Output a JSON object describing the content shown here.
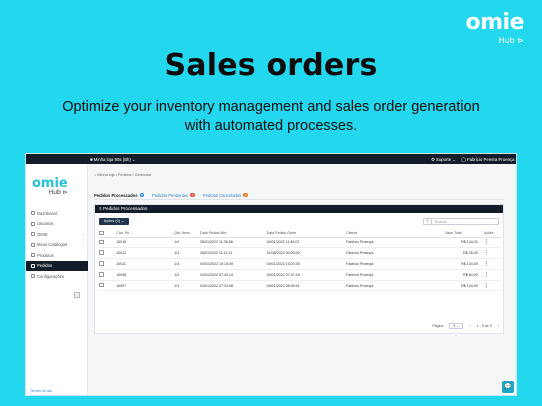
{
  "brand": {
    "word": "omie",
    "sub": "Hub ⊳"
  },
  "hero": {
    "title": "Sales orders",
    "subtitle": "Optimize your inventory management and sales order generation with automated processes."
  },
  "app": {
    "topbar": {
      "org": "■ Minha loja  90s (Bh) ⌄",
      "support": "⚙ Suporte  ⌄",
      "user": "◯ Fabricio Pereira Proença  ⌄"
    },
    "sidebar": {
      "logo_word": "omie",
      "logo_sub": "Hub ⊳",
      "items": [
        {
          "label": "Dashboard"
        },
        {
          "label": "Usuários"
        },
        {
          "label": "OMIE"
        },
        {
          "label": "Meus Catálogos"
        },
        {
          "label": "Produtos"
        },
        {
          "label": "Pedidos"
        },
        {
          "label": "Configurações"
        }
      ],
      "footer": "Termos de uso"
    },
    "breadcrumb": "⌂ Minha loja  /  Pedidos  /  Gerenciar",
    "tabs": [
      {
        "label": "Pedidos Processados",
        "count": "5",
        "color": "#2e86de"
      },
      {
        "label": "Pedidos Pendentes",
        "count": "0",
        "color": "#e74c3c"
      },
      {
        "label": "Pedidos Cancelados",
        "count": "0",
        "color": "#e67e22"
      }
    ],
    "card": {
      "title": "≡ Pedidos Processados",
      "actions_label": "Ações (0) ⌄",
      "search_placeholder": "Buscar",
      "columns": [
        "",
        "Cód. Pe...",
        "Qtd. Itens",
        "Data Pedido Nfe",
        "Data Pedido Omie",
        "Cliente",
        "Valor Total",
        "Ações"
      ],
      "rows": [
        {
          "id": "10016",
          "qty": "1/4",
          "date_nfe": "28/01/2022 11:36:58",
          "date_omie": "04/01/2022 11:46:07",
          "client": "Fabricio Proença",
          "total": "R$ 144,00"
        },
        {
          "id": "10012",
          "qty": "1/3",
          "date_nfe": "28/01/2022 11:11:31",
          "date_omie": "01/08/2022 00:00:00",
          "client": "Fabricio Proença",
          "total": "R$ 26,00"
        },
        {
          "id": "10011",
          "qty": "1/4",
          "date_nfe": "04/01/2022 15:15:49",
          "date_omie": "04/01/2022 15:20:35",
          "client": "Fabricio Proença",
          "total": "R$ 144,00"
        },
        {
          "id": "10008",
          "qty": "1/2",
          "date_nfe": "04/01/2022 07:43:14",
          "date_omie": "04/01/2022 07:47:18",
          "client": "Fabricio Proença",
          "total": "R$ 84,00"
        },
        {
          "id": "10007",
          "qty": "1/1",
          "date_nfe": "04/01/2022 07:24:08",
          "date_omie": "04/01/2022 08:39:51",
          "client": "Fabricio Proença",
          "total": "R$ 144,00"
        }
      ],
      "pager": {
        "label": "Página",
        "size": "5 ⌄",
        "range": "1 - 5 de 5",
        "prev": "‹",
        "next": "›"
      }
    },
    "chat_icon": "💬"
  }
}
